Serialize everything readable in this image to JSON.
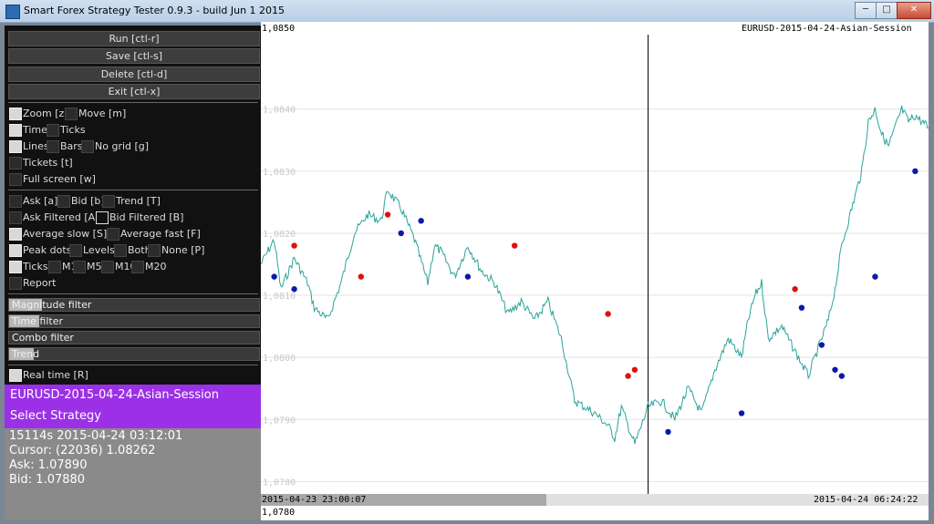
{
  "window": {
    "title": "Smart Forex Strategy Tester 0.9.3 - build Jun  1 2015",
    "min": "─",
    "max": "□",
    "close": "✕"
  },
  "buttons": {
    "run": "Run [ctl-r]",
    "save": "Save [ctl-s]",
    "delete": "Delete [ctl-d]",
    "exit": "Exit [ctl-x]"
  },
  "options": {
    "zoom": "Zoom [z]",
    "move": "Move [m]",
    "time": "Time",
    "ticks": "Ticks",
    "lines": "Lines",
    "bars": "Bars",
    "nogrid": "No grid [g]",
    "tickets": "Tickets [t]",
    "fullscreen": "Full screen [w]",
    "ask": "Ask [a]",
    "bid": "Bid [b]",
    "trend": "Trend [T]",
    "ask_filtered": "Ask Filtered [A]",
    "bid_filtered": "Bid Filtered [B]",
    "avg_slow": "Average slow [S]",
    "avg_fast": "Average fast [F]",
    "peak_dots": "Peak dots",
    "levels": "Levels",
    "both": "Both",
    "none": "None [P]",
    "ticks2": "Ticks",
    "m1": "M1",
    "m5": "M5",
    "m10": "M10",
    "m20": "M20",
    "report": "Report",
    "realtime": "Real time [R]"
  },
  "filters": [
    {
      "label": "Magnitude filter",
      "fill": 0.13
    },
    {
      "label": "Time filter",
      "fill": 0.12
    },
    {
      "label": "Combo filter",
      "fill": 0.0
    },
    {
      "label": "Trend",
      "fill": 0.1
    }
  ],
  "session": {
    "name": "EURUSD-2015-04-24-Asian-Session",
    "strategy": "Select Strategy"
  },
  "info": {
    "line1": "15114s  2015-04-24  03:12:01",
    "line2": "Cursor: (22036) 1.08262",
    "line3": "Ask: 1.07890",
    "line4": "Bid: 1.07880"
  },
  "chart_labels": {
    "top_price": "1,0850",
    "title": "EURUSD-2015-04-24-Asian-Session",
    "start_time": "2015-04-23 23:00:07",
    "end_time": "2015-04-24 06:24:22",
    "bottom_price": "1,0780"
  },
  "chart_data": {
    "type": "line",
    "ylim": [
      1.0778,
      1.0852
    ],
    "yticks": [
      "1,0840",
      "1,0830",
      "1,0820",
      "1,0810",
      "1,0800",
      "1,0790",
      "1,0780"
    ],
    "cursor_x": 0.58,
    "colors": {
      "line": "#2aa39a",
      "peak": "#e01010",
      "valley": "#0b1aa8"
    },
    "x": [
      0,
      0.02,
      0.03,
      0.05,
      0.07,
      0.08,
      0.1,
      0.12,
      0.14,
      0.16,
      0.18,
      0.19,
      0.21,
      0.23,
      0.25,
      0.26,
      0.27,
      0.29,
      0.31,
      0.33,
      0.35,
      0.37,
      0.39,
      0.41,
      0.43,
      0.45,
      0.47,
      0.5,
      0.52,
      0.53,
      0.54,
      0.56,
      0.57,
      0.58,
      0.6,
      0.62,
      0.64,
      0.66,
      0.68,
      0.7,
      0.72,
      0.73,
      0.74,
      0.75,
      0.76,
      0.78,
      0.8,
      0.82,
      0.84,
      0.85,
      0.86,
      0.87,
      0.88,
      0.89,
      0.9,
      0.91,
      0.92,
      0.93,
      0.94,
      0.95,
      0.96,
      0.97,
      0.98,
      0.99,
      1.0
    ],
    "y": [
      1.0815,
      1.0819,
      1.0811,
      1.0816,
      1.0812,
      1.0808,
      1.0806,
      1.0812,
      1.082,
      1.0823,
      1.0822,
      1.0827,
      1.0824,
      1.0819,
      1.0812,
      1.0818,
      1.0817,
      1.0813,
      1.0818,
      1.0814,
      1.0812,
      1.0807,
      1.0809,
      1.0806,
      1.0809,
      1.0803,
      1.0793,
      1.0791,
      1.0789,
      1.0787,
      1.0792,
      1.0786,
      1.0789,
      1.0792,
      1.0793,
      1.079,
      1.0795,
      1.0791,
      1.0798,
      1.0803,
      1.08,
      1.0806,
      1.081,
      1.0812,
      1.0803,
      1.0805,
      1.0801,
      1.0797,
      1.0803,
      1.0806,
      1.0811,
      1.0818,
      1.0822,
      1.0826,
      1.083,
      1.0838,
      1.084,
      1.0836,
      1.0834,
      1.0837,
      1.084,
      1.0838,
      1.0839,
      1.0838,
      1.0837
    ],
    "peaks": [
      [
        0.05,
        1.0818
      ],
      [
        0.15,
        1.0813
      ],
      [
        0.19,
        1.0823
      ],
      [
        0.38,
        1.0818
      ],
      [
        0.52,
        1.0807
      ],
      [
        0.55,
        1.0797
      ],
      [
        0.56,
        1.0798
      ],
      [
        0.8,
        1.0811
      ]
    ],
    "valleys": [
      [
        0.02,
        1.0813
      ],
      [
        0.05,
        1.0811
      ],
      [
        0.21,
        1.082
      ],
      [
        0.24,
        1.0822
      ],
      [
        0.31,
        1.0813
      ],
      [
        0.61,
        1.0788
      ],
      [
        0.72,
        1.0791
      ],
      [
        0.81,
        1.0808
      ],
      [
        0.84,
        1.0802
      ],
      [
        0.86,
        1.0798
      ],
      [
        0.87,
        1.0797
      ],
      [
        0.92,
        1.0813
      ],
      [
        0.98,
        1.083
      ]
    ]
  }
}
